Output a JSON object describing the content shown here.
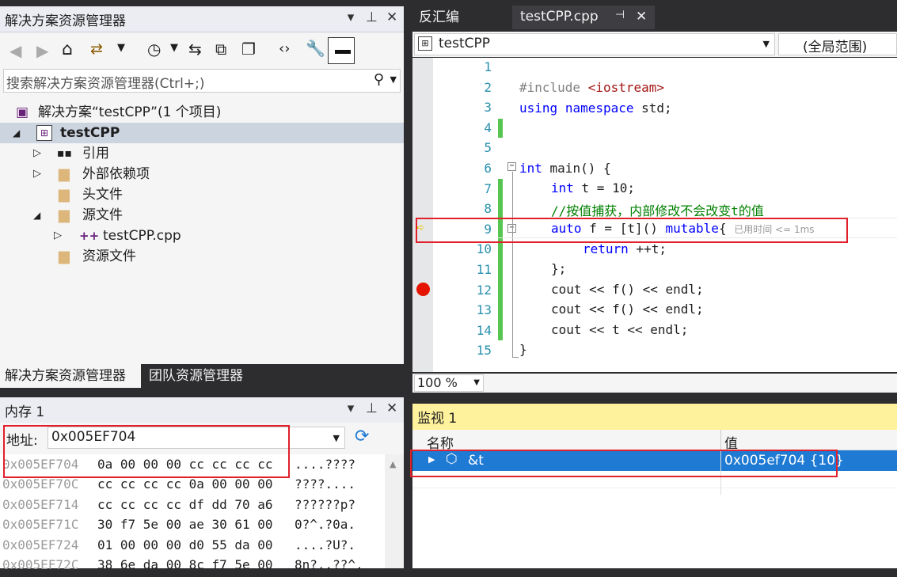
{
  "solution_explorer": {
    "title": "解决方案资源管理器",
    "search_placeholder": "搜索解决方案资源管理器(Ctrl+;)",
    "solution_label": "解决方案“testCPP”(1 个项目)",
    "project": "testCPP",
    "items": [
      "引用",
      "外部依赖项",
      "头文件",
      "源文件",
      "testCPP.cpp",
      "资源文件"
    ],
    "bottom_tabs": [
      "解决方案资源管理器",
      "团队资源管理器"
    ]
  },
  "editor": {
    "tabs": [
      "反汇编",
      "testCPP.cpp"
    ],
    "project_dropdown": "testCPP",
    "scope_dropdown": "(全局范围)",
    "zoom": "100 %",
    "timing_hint": "已用时间 <= 1ms",
    "line_numbers": [
      "1",
      "2",
      "3",
      "4",
      "5",
      "6",
      "7",
      "8",
      "9",
      "10",
      "11",
      "12",
      "13",
      "14",
      "15"
    ]
  },
  "memory": {
    "title": "内存 1",
    "address_label": "地址:",
    "address_value": "0x005EF704",
    "rows": [
      {
        "addr": "0x005EF704",
        "bytes": "0a 00 00 00 cc cc cc cc",
        "ascii": "....????"
      },
      {
        "addr": "0x005EF70C",
        "bytes": "cc cc cc cc 0a 00 00 00",
        "ascii": "????...."
      },
      {
        "addr": "0x005EF714",
        "bytes": "cc cc cc cc df dd 70 a6",
        "ascii": "??????p?"
      },
      {
        "addr": "0x005EF71C",
        "bytes": "30 f7 5e 00 ae 30 61 00",
        "ascii": "0?^.?0a."
      },
      {
        "addr": "0x005EF724",
        "bytes": "01 00 00 00 d0 55 da 00",
        "ascii": "....?U?."
      },
      {
        "addr": "0x005EF72C",
        "bytes": "38 6e da 00 8c f7 5e 00",
        "ascii": "8n?..??^."
      }
    ]
  },
  "watch": {
    "title": "监视 1",
    "col_name": "名称",
    "col_value": "值",
    "rows": [
      {
        "name": "&t",
        "value": "0x005ef704 {10}"
      }
    ]
  }
}
